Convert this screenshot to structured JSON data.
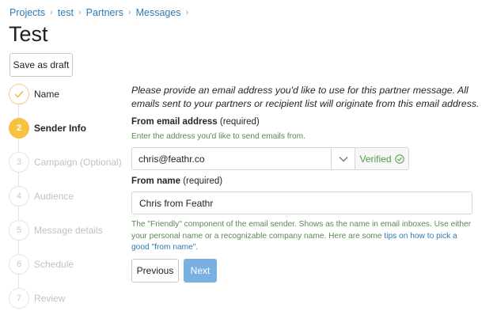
{
  "breadcrumb": [
    "Projects",
    "test",
    "Partners",
    "Messages"
  ],
  "page_title": "Test",
  "save_draft_label": "Save as draft",
  "steps": [
    {
      "number": "",
      "label": "Name",
      "state": "done"
    },
    {
      "number": "2",
      "label": "Sender Info",
      "state": "active"
    },
    {
      "number": "3",
      "label": "Campaign (Optional)",
      "state": "todo"
    },
    {
      "number": "4",
      "label": "Audience",
      "state": "todo"
    },
    {
      "number": "5",
      "label": "Message details",
      "state": "todo"
    },
    {
      "number": "6",
      "label": "Schedule",
      "state": "todo"
    },
    {
      "number": "7",
      "label": "Review",
      "state": "todo"
    }
  ],
  "form": {
    "intro": "Please provide an email address you'd like to use for this partner message. All emails sent to your partners or recipient list will originate from this email address.",
    "from_email": {
      "label": "From email address",
      "required": "(required)",
      "help": "Enter the address you'd like to send emails from.",
      "value": "chris@feathr.co",
      "status": "Verified"
    },
    "from_name": {
      "label": "From name",
      "required": "(required)",
      "value": "Chris from Feathr",
      "help": "The \"Friendly\" component of the email sender. Shows as the name in email inboxes. Use either your personal name or a recognizable company name. Here are some ",
      "help_link": "tips on how to pick a good \"from name\"",
      "help_end": "."
    },
    "buttons": {
      "previous": "Previous",
      "next": "Next"
    }
  },
  "colors": {
    "link": "#2d7ab5",
    "step_active": "#f5c242",
    "help_text": "#5a8a53",
    "verified": "#4f9a48",
    "next_button": "#7ab0e0"
  },
  "icons": {
    "check": "check-icon",
    "chevron": "chevron-down-icon",
    "verified": "check-circle-icon",
    "separator": "chevron-right-icon"
  }
}
